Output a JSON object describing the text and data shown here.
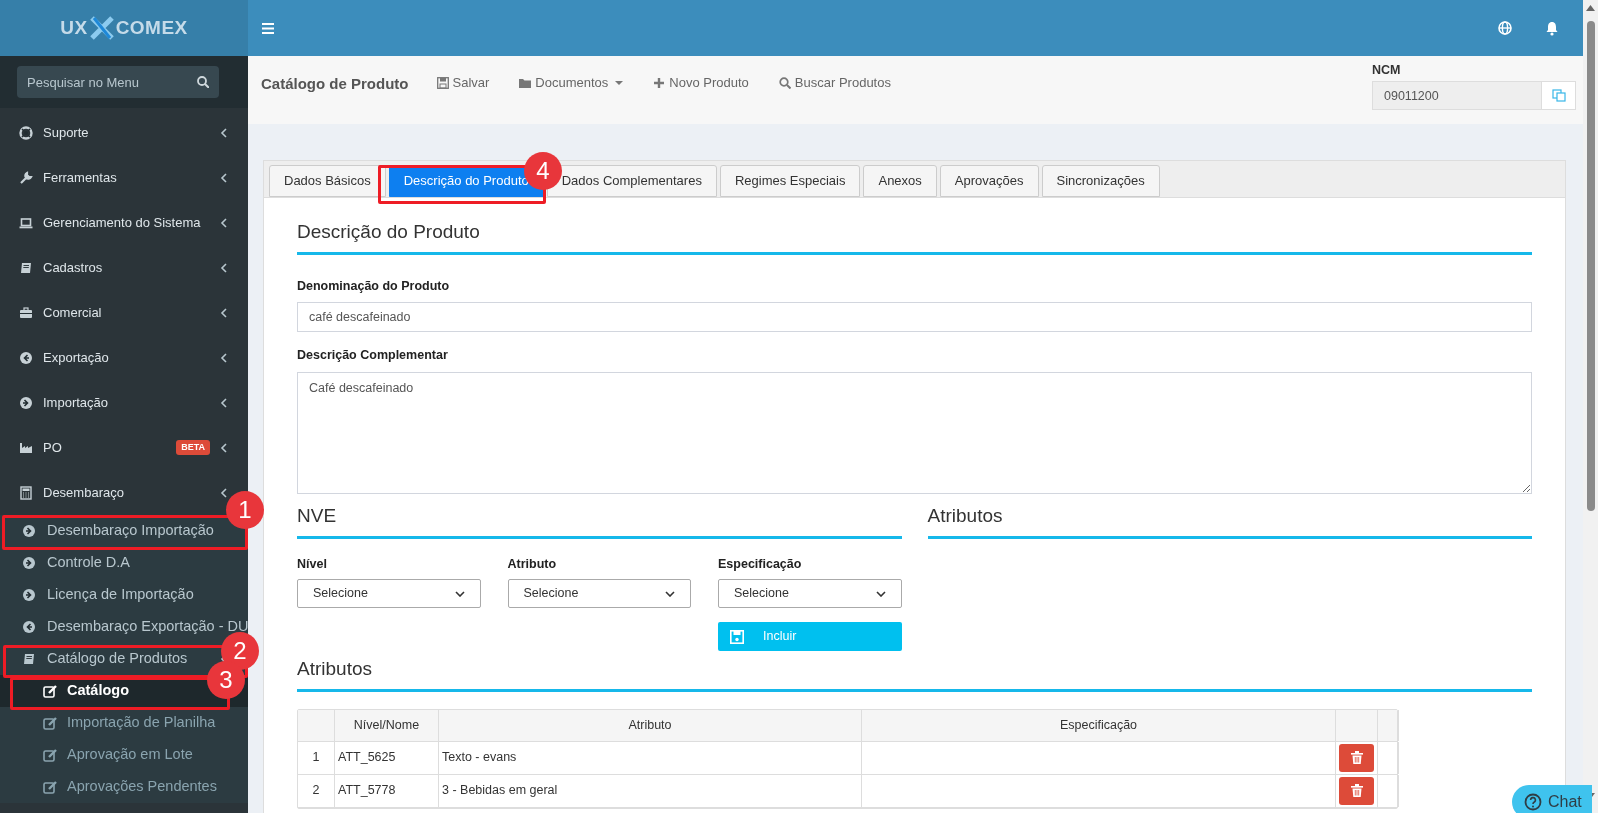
{
  "logo": {
    "left": "UX",
    "right": "COMEX"
  },
  "sidebar": {
    "search_placeholder": "Pesquisar no Menu",
    "items": [
      {
        "label": "Suporte"
      },
      {
        "label": "Ferramentas"
      },
      {
        "label": "Gerenciamento do Sistema"
      },
      {
        "label": "Cadastros"
      },
      {
        "label": "Comercial"
      },
      {
        "label": "Exportação"
      },
      {
        "label": "Importação"
      },
      {
        "label": "PO",
        "badge": "BETA"
      },
      {
        "label": "Desembaraço",
        "children": [
          {
            "label": "Desembaraço Importação"
          },
          {
            "label": "Controle D.A"
          },
          {
            "label": "Licença de Importação"
          },
          {
            "label": "Desembaraço Exportação - DU"
          },
          {
            "label": "Catálogo de Produtos",
            "children": [
              {
                "label": "Catálogo",
                "selected": true
              },
              {
                "label": "Importação de Planilha",
                "selected": false
              },
              {
                "label": "Aprovação em Lote",
                "selected": false
              },
              {
                "label": "Aprovações Pendentes",
                "selected": false
              }
            ]
          }
        ]
      }
    ]
  },
  "toolbar": {
    "title": "Catálogo de Produto",
    "actions": [
      {
        "label": "Salvar"
      },
      {
        "label": "Documentos"
      },
      {
        "label": "Novo Produto"
      },
      {
        "label": "Buscar Produtos"
      }
    ],
    "ncm_label": "NCM",
    "ncm_value": "09011200"
  },
  "tabs": [
    {
      "label": "Dados Básicos",
      "selected": false
    },
    {
      "label": "Descrição do Produto",
      "selected": true
    },
    {
      "label": "Dados Complementares",
      "selected": false
    },
    {
      "label": "Regimes Especiais",
      "selected": false
    },
    {
      "label": "Anexos",
      "selected": false
    },
    {
      "label": "Aprovações",
      "selected": false
    },
    {
      "label": "Sincronizações",
      "selected": false
    }
  ],
  "section_title": "Descrição do Produto",
  "denominacao": {
    "label": "Denominação do Produto",
    "value": "café descafeinado"
  },
  "complementar": {
    "label": "Descrição Complementar",
    "value": "Café descafeinado"
  },
  "nve": {
    "title": "NVE",
    "selects": [
      {
        "label": "Nível",
        "value": "Selecione"
      },
      {
        "label": "Atributo",
        "value": "Selecione"
      },
      {
        "label": "Especificação",
        "value": "Selecione"
      }
    ],
    "button": "Incluir"
  },
  "atributos_side_title": "Atributos",
  "atributos": {
    "title": "Atributos",
    "columns": [
      "Nível/Nome",
      "Atributo",
      "Especificação"
    ],
    "rows": [
      {
        "index": "1",
        "name": "ATT_5625",
        "attribute": "Texto - evans"
      },
      {
        "index": "2",
        "name": "ATT_5778",
        "attribute": "3 - Bebidas em geral"
      }
    ]
  },
  "chat": "Chat",
  "annotations": [
    {
      "label": "1"
    },
    {
      "label": "2"
    },
    {
      "label": "3"
    },
    {
      "label": "4"
    }
  ]
}
